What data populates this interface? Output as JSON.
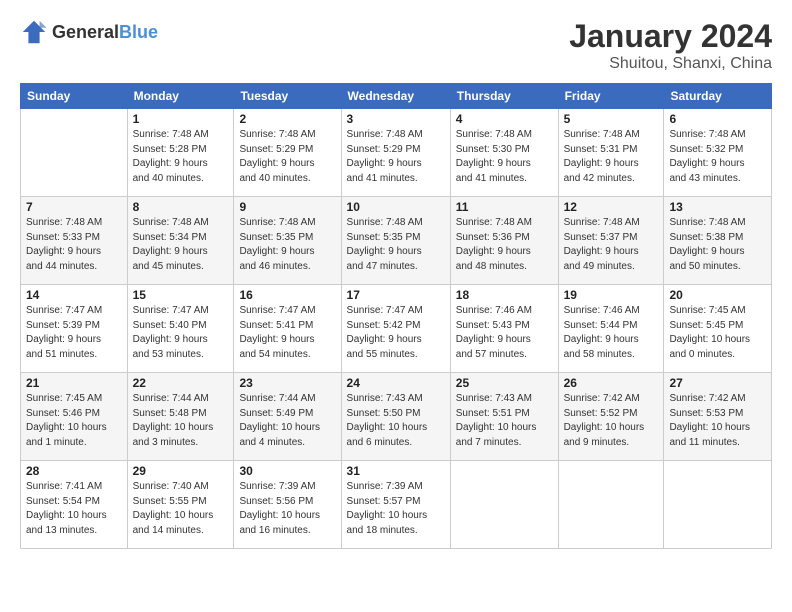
{
  "header": {
    "logo_general": "General",
    "logo_blue": "Blue",
    "month_title": "January 2024",
    "location": "Shuitou, Shanxi, China"
  },
  "days_of_week": [
    "Sunday",
    "Monday",
    "Tuesday",
    "Wednesday",
    "Thursday",
    "Friday",
    "Saturday"
  ],
  "weeks": [
    [
      {
        "day": "",
        "info": ""
      },
      {
        "day": "1",
        "info": "Sunrise: 7:48 AM\nSunset: 5:28 PM\nDaylight: 9 hours\nand 40 minutes."
      },
      {
        "day": "2",
        "info": "Sunrise: 7:48 AM\nSunset: 5:29 PM\nDaylight: 9 hours\nand 40 minutes."
      },
      {
        "day": "3",
        "info": "Sunrise: 7:48 AM\nSunset: 5:29 PM\nDaylight: 9 hours\nand 41 minutes."
      },
      {
        "day": "4",
        "info": "Sunrise: 7:48 AM\nSunset: 5:30 PM\nDaylight: 9 hours\nand 41 minutes."
      },
      {
        "day": "5",
        "info": "Sunrise: 7:48 AM\nSunset: 5:31 PM\nDaylight: 9 hours\nand 42 minutes."
      },
      {
        "day": "6",
        "info": "Sunrise: 7:48 AM\nSunset: 5:32 PM\nDaylight: 9 hours\nand 43 minutes."
      }
    ],
    [
      {
        "day": "7",
        "info": "Sunrise: 7:48 AM\nSunset: 5:33 PM\nDaylight: 9 hours\nand 44 minutes."
      },
      {
        "day": "8",
        "info": "Sunrise: 7:48 AM\nSunset: 5:34 PM\nDaylight: 9 hours\nand 45 minutes."
      },
      {
        "day": "9",
        "info": "Sunrise: 7:48 AM\nSunset: 5:35 PM\nDaylight: 9 hours\nand 46 minutes."
      },
      {
        "day": "10",
        "info": "Sunrise: 7:48 AM\nSunset: 5:35 PM\nDaylight: 9 hours\nand 47 minutes."
      },
      {
        "day": "11",
        "info": "Sunrise: 7:48 AM\nSunset: 5:36 PM\nDaylight: 9 hours\nand 48 minutes."
      },
      {
        "day": "12",
        "info": "Sunrise: 7:48 AM\nSunset: 5:37 PM\nDaylight: 9 hours\nand 49 minutes."
      },
      {
        "day": "13",
        "info": "Sunrise: 7:48 AM\nSunset: 5:38 PM\nDaylight: 9 hours\nand 50 minutes."
      }
    ],
    [
      {
        "day": "14",
        "info": "Sunrise: 7:47 AM\nSunset: 5:39 PM\nDaylight: 9 hours\nand 51 minutes."
      },
      {
        "day": "15",
        "info": "Sunrise: 7:47 AM\nSunset: 5:40 PM\nDaylight: 9 hours\nand 53 minutes."
      },
      {
        "day": "16",
        "info": "Sunrise: 7:47 AM\nSunset: 5:41 PM\nDaylight: 9 hours\nand 54 minutes."
      },
      {
        "day": "17",
        "info": "Sunrise: 7:47 AM\nSunset: 5:42 PM\nDaylight: 9 hours\nand 55 minutes."
      },
      {
        "day": "18",
        "info": "Sunrise: 7:46 AM\nSunset: 5:43 PM\nDaylight: 9 hours\nand 57 minutes."
      },
      {
        "day": "19",
        "info": "Sunrise: 7:46 AM\nSunset: 5:44 PM\nDaylight: 9 hours\nand 58 minutes."
      },
      {
        "day": "20",
        "info": "Sunrise: 7:45 AM\nSunset: 5:45 PM\nDaylight: 10 hours\nand 0 minutes."
      }
    ],
    [
      {
        "day": "21",
        "info": "Sunrise: 7:45 AM\nSunset: 5:46 PM\nDaylight: 10 hours\nand 1 minute."
      },
      {
        "day": "22",
        "info": "Sunrise: 7:44 AM\nSunset: 5:48 PM\nDaylight: 10 hours\nand 3 minutes."
      },
      {
        "day": "23",
        "info": "Sunrise: 7:44 AM\nSunset: 5:49 PM\nDaylight: 10 hours\nand 4 minutes."
      },
      {
        "day": "24",
        "info": "Sunrise: 7:43 AM\nSunset: 5:50 PM\nDaylight: 10 hours\nand 6 minutes."
      },
      {
        "day": "25",
        "info": "Sunrise: 7:43 AM\nSunset: 5:51 PM\nDaylight: 10 hours\nand 7 minutes."
      },
      {
        "day": "26",
        "info": "Sunrise: 7:42 AM\nSunset: 5:52 PM\nDaylight: 10 hours\nand 9 minutes."
      },
      {
        "day": "27",
        "info": "Sunrise: 7:42 AM\nSunset: 5:53 PM\nDaylight: 10 hours\nand 11 minutes."
      }
    ],
    [
      {
        "day": "28",
        "info": "Sunrise: 7:41 AM\nSunset: 5:54 PM\nDaylight: 10 hours\nand 13 minutes."
      },
      {
        "day": "29",
        "info": "Sunrise: 7:40 AM\nSunset: 5:55 PM\nDaylight: 10 hours\nand 14 minutes."
      },
      {
        "day": "30",
        "info": "Sunrise: 7:39 AM\nSunset: 5:56 PM\nDaylight: 10 hours\nand 16 minutes."
      },
      {
        "day": "31",
        "info": "Sunrise: 7:39 AM\nSunset: 5:57 PM\nDaylight: 10 hours\nand 18 minutes."
      },
      {
        "day": "",
        "info": ""
      },
      {
        "day": "",
        "info": ""
      },
      {
        "day": "",
        "info": ""
      }
    ]
  ]
}
